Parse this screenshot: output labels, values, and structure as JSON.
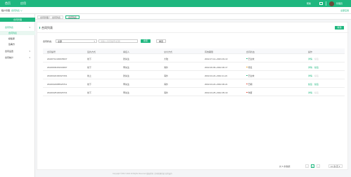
{
  "topbar": {
    "nav": [
      "首页",
      "应用"
    ],
    "right_text": "帮助",
    "user_name": "管理员",
    "accent": "#1fb77f"
  },
  "subbar": {
    "label": "租户管理",
    "select_value": "合同列表 ∨",
    "link": "全部应用"
  },
  "sidebar": {
    "top_item": "合同管理",
    "groups": [
      {
        "label": "合同列表",
        "chevron": "▾"
      },
      {
        "label": "合同设置",
        "chevron": "▾"
      },
      {
        "label": "合同统计",
        "chevron": "▾"
      }
    ],
    "sub_items": [
      "合同列表",
      "模板库",
      "签署方"
    ]
  },
  "breadcrumb": [
    "合同管理",
    "合同列表",
    "合同列表"
  ],
  "panel": {
    "title": "合同列表",
    "add_button": "新建"
  },
  "filter": {
    "label": "合同状态：",
    "select_value": "全部",
    "input_placeholder": "请输入合同编号/名称",
    "search_button": "搜索",
    "reset_button": "重置"
  },
  "table": {
    "columns": [
      "合同编号",
      "签约方式",
      "承接人",
      "交付方式",
      "有效期限",
      "合同状态",
      "操作"
    ],
    "rows": [
      {
        "id": "20220714100035037",
        "sign": "线下",
        "owner": "张先生",
        "delivery": "大陆",
        "period": "2022-07-14~2023-03-13",
        "status": "已生效",
        "status_color": "#1fb77f",
        "actions": [
          "详情",
          "续签"
        ],
        "disabled_actions": [
          1
        ]
      },
      {
        "id": "20220609152333097",
        "sign": "线下",
        "owner": "李先生",
        "delivery": "海外",
        "period": "2022-06-09~2022-06-17",
        "status": "待签",
        "status_color": "#f5a623",
        "actions": [
          "详情",
          "续签"
        ],
        "disabled_actions": []
      },
      {
        "id": "20220422160327291",
        "sign": "线上",
        "owner": "张先生",
        "delivery": "海外",
        "period": "2022-04-22~2022-11-21",
        "status": "已生效",
        "status_color": "#1fb77f",
        "actions": [
          "详情",
          "续签"
        ],
        "disabled_actions": [
          1
        ]
      },
      {
        "id": "20220422085326711",
        "sign": "线下",
        "owner": "李先生",
        "delivery": "海外",
        "period": "2022-04-22~2022-06-21",
        "status": "已期",
        "status_color": "#e74c3c",
        "actions": [
          "续签",
          "续签"
        ],
        "disabled_actions": []
      },
      {
        "id": "20220425100326731",
        "sign": "线下",
        "owner": "李先生",
        "delivery": "海外",
        "period": "2022-04-25~2022-05-19",
        "status": "作废",
        "status_color": "#e74c3c",
        "actions": [
          "详情",
          "续签"
        ],
        "disabled_actions": [
          1
        ]
      }
    ]
  },
  "pager": {
    "total": "共 5 条数据",
    "prev": "‹",
    "current": "1",
    "next": "›",
    "size": "10 条/页 ▾"
  },
  "footer": "Copyright ©2017-2021 All Rights Reserved 版权所有 合同管理系统 技术支持"
}
